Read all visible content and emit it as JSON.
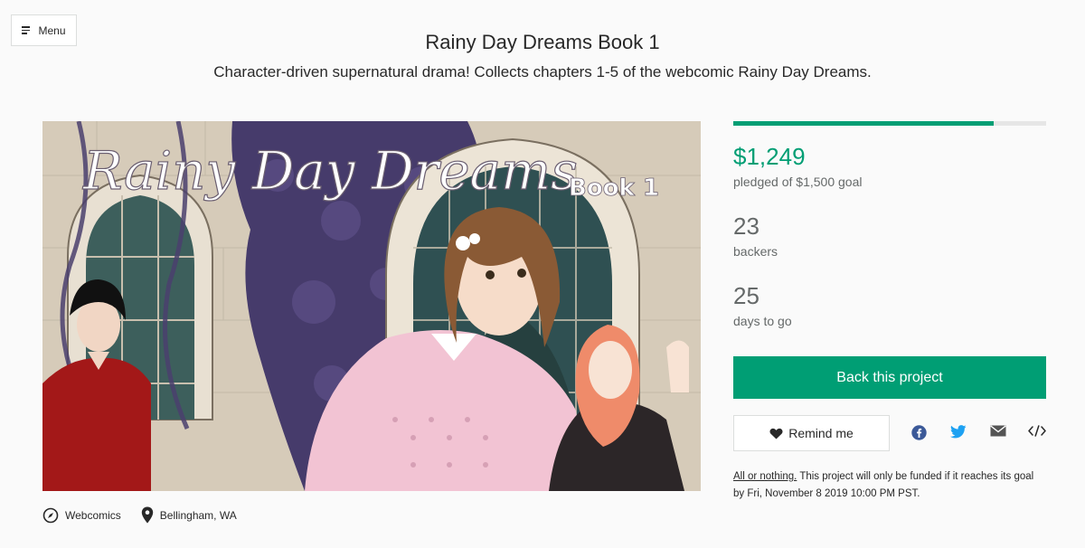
{
  "header": {
    "menu_label": "Menu",
    "title": "Rainy Day Dreams Book 1",
    "subtitle": "Character-driven supernatural drama! Collects chapters 1-5 of the webcomic Rainy Day Dreams."
  },
  "hero": {
    "cover_title": "Rainy Day Dreams",
    "cover_book": "Book 1"
  },
  "meta": {
    "category": "Webcomics",
    "location": "Bellingham, WA",
    "category_icon": "compass-icon",
    "location_icon": "map-pin-icon"
  },
  "funding": {
    "progress_fraction": 0.8327,
    "pledged": "$1,249",
    "pledged_caption": "pledged of $1,500 goal",
    "backers": "23",
    "backers_caption": "backers",
    "days": "25",
    "days_caption": "days to go"
  },
  "actions": {
    "back_label": "Back this project",
    "remind_label": "Remind me",
    "share_icons": [
      "facebook-icon",
      "twitter-icon",
      "email-icon",
      "embed-icon"
    ]
  },
  "fine_print": {
    "link": "All or nothing.",
    "text": " This project will only be funded if it reaches its goal by Fri, November 8 2019 10:00 PM PST."
  },
  "colors": {
    "accent": "#009e74",
    "muted_text": "#656969",
    "progress_track": "#e6e6e6",
    "facebook": "#3b5998",
    "twitter": "#1da1f2"
  }
}
